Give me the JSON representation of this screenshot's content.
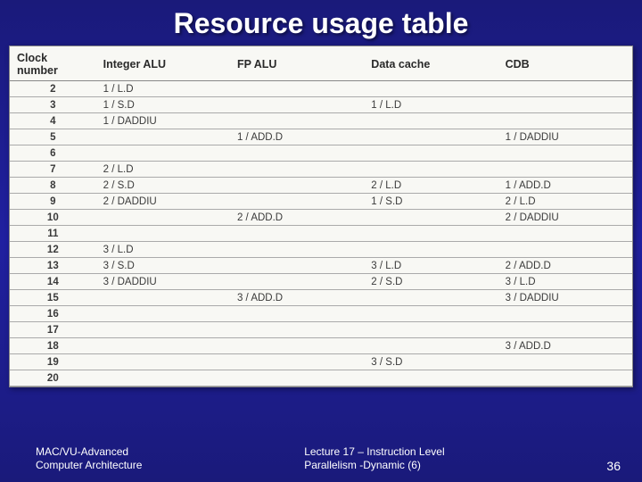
{
  "title": "Resource usage table",
  "chart_data": {
    "type": "table",
    "columns": [
      "Clock number",
      "Integer ALU",
      "FP ALU",
      "Data cache",
      "CDB"
    ],
    "rows": [
      {
        "clock": "2",
        "int_alu": "1 / L.D",
        "fp_alu": "",
        "data_cache": "",
        "cdb": ""
      },
      {
        "clock": "3",
        "int_alu": "1 / S.D",
        "fp_alu": "",
        "data_cache": "1 / L.D",
        "cdb": ""
      },
      {
        "clock": "4",
        "int_alu": "1 / DADDIU",
        "fp_alu": "",
        "data_cache": "",
        "cdb": ""
      },
      {
        "clock": "5",
        "int_alu": "",
        "fp_alu": "1 / ADD.D",
        "data_cache": "",
        "cdb": "1 / DADDIU"
      },
      {
        "clock": "6",
        "int_alu": "",
        "fp_alu": "",
        "data_cache": "",
        "cdb": ""
      },
      {
        "clock": "7",
        "int_alu": "2 / L.D",
        "fp_alu": "",
        "data_cache": "",
        "cdb": ""
      },
      {
        "clock": "8",
        "int_alu": "2 / S.D",
        "fp_alu": "",
        "data_cache": "2 / L.D",
        "cdb": "1 / ADD.D"
      },
      {
        "clock": "9",
        "int_alu": "2 / DADDIU",
        "fp_alu": "",
        "data_cache": "1 / S.D",
        "cdb": "2 / L.D"
      },
      {
        "clock": "10",
        "int_alu": "",
        "fp_alu": "2 / ADD.D",
        "data_cache": "",
        "cdb": "2 / DADDIU"
      },
      {
        "clock": "11",
        "int_alu": "",
        "fp_alu": "",
        "data_cache": "",
        "cdb": ""
      },
      {
        "clock": "12",
        "int_alu": "3 / L.D",
        "fp_alu": "",
        "data_cache": "",
        "cdb": ""
      },
      {
        "clock": "13",
        "int_alu": "3 / S.D",
        "fp_alu": "",
        "data_cache": "3 / L.D",
        "cdb": "2 / ADD.D"
      },
      {
        "clock": "14",
        "int_alu": "3 / DADDIU",
        "fp_alu": "",
        "data_cache": "2 / S.D",
        "cdb": "3 / L.D"
      },
      {
        "clock": "15",
        "int_alu": "",
        "fp_alu": "3 / ADD.D",
        "data_cache": "",
        "cdb": "3 / DADDIU"
      },
      {
        "clock": "16",
        "int_alu": "",
        "fp_alu": "",
        "data_cache": "",
        "cdb": ""
      },
      {
        "clock": "17",
        "int_alu": "",
        "fp_alu": "",
        "data_cache": "",
        "cdb": ""
      },
      {
        "clock": "18",
        "int_alu": "",
        "fp_alu": "",
        "data_cache": "",
        "cdb": "3 / ADD.D"
      },
      {
        "clock": "19",
        "int_alu": "",
        "fp_alu": "",
        "data_cache": "3 / S.D",
        "cdb": ""
      },
      {
        "clock": "20",
        "int_alu": "",
        "fp_alu": "",
        "data_cache": "",
        "cdb": ""
      }
    ]
  },
  "footer": {
    "left_line1": "MAC/VU-Advanced",
    "left_line2": "Computer Architecture",
    "mid_line1": "Lecture 17 – Instruction Level",
    "mid_line2": "Parallelism -Dynamic (6)",
    "page": "36"
  }
}
